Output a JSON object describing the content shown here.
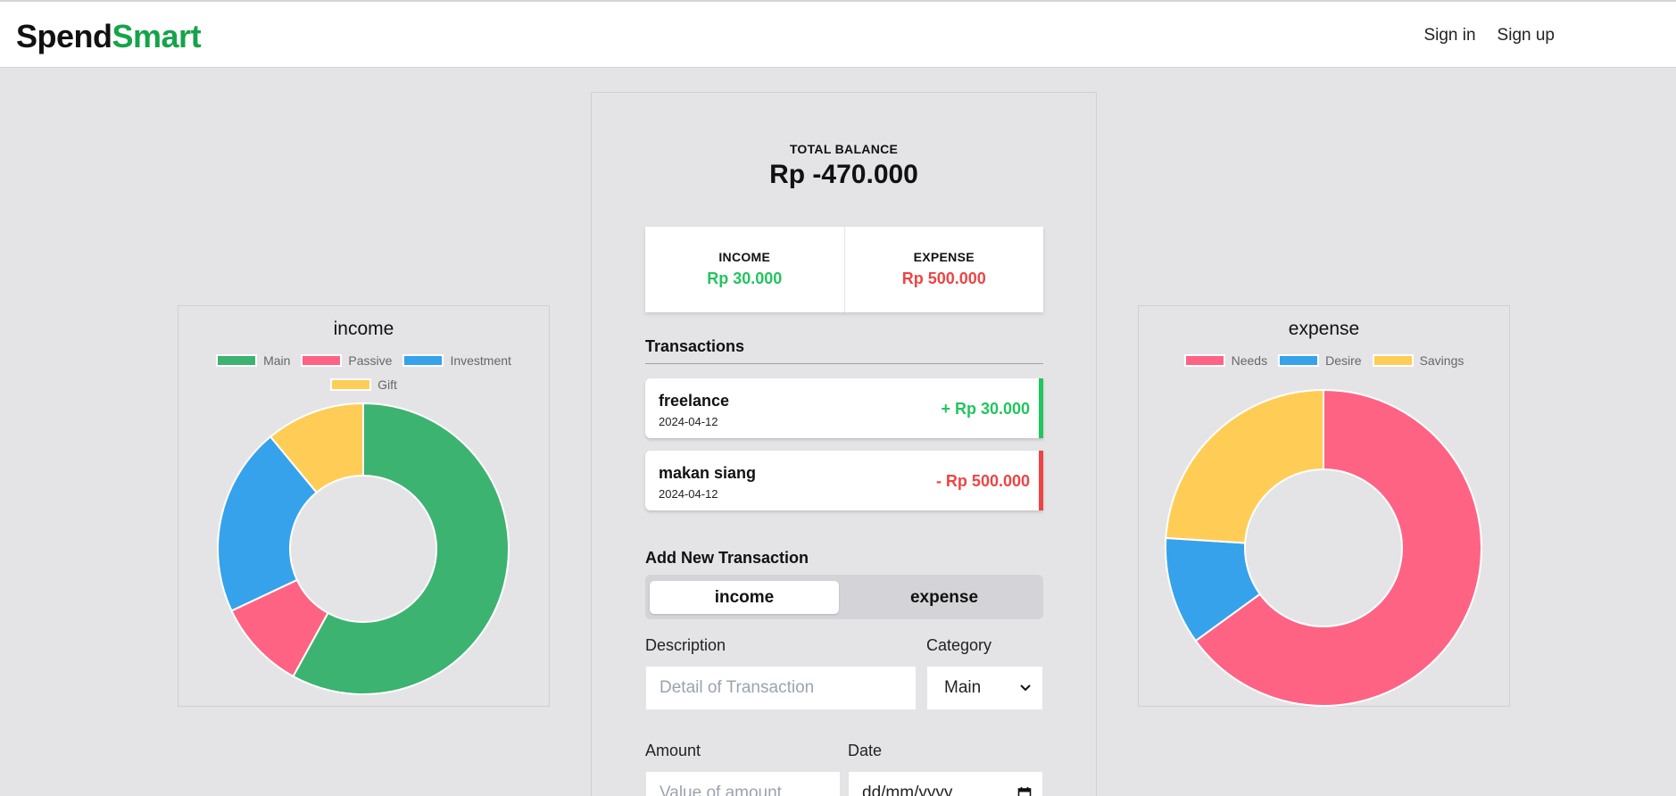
{
  "brand": {
    "part1": "Spend",
    "part2": "Smart"
  },
  "nav": {
    "sign_in": "Sign in",
    "sign_up": "Sign up"
  },
  "balance": {
    "label": "TOTAL BALANCE",
    "value": "Rp -470.000"
  },
  "summary": {
    "income_label": "INCOME",
    "income_value": "Rp 30.000",
    "expense_label": "EXPENSE",
    "expense_value": "Rp 500.000"
  },
  "transactions": {
    "title": "Transactions",
    "items": [
      {
        "name": "freelance",
        "date": "2024-04-12",
        "amount": "+ Rp 30.000",
        "type": "income"
      },
      {
        "name": "makan siang",
        "date": "2024-04-12",
        "amount": "- Rp 500.000",
        "type": "expense"
      }
    ]
  },
  "form": {
    "title": "Add New Transaction",
    "tab_income": "income",
    "tab_expense": "expense",
    "description_label": "Description",
    "description_placeholder": "Detail of Transaction",
    "category_label": "Category",
    "category_value": "Main",
    "amount_label": "Amount",
    "amount_placeholder": "Value of amount",
    "date_label": "Date",
    "date_placeholder": "dd/mm/yyyy"
  },
  "colors": {
    "green": "#3cb371",
    "pink": "#ff6384",
    "blue": "#36a2eb",
    "yellow": "#ffcd56",
    "brand_green": "#16a34a",
    "income_green": "#22c55e",
    "expense_red": "#ef4444"
  },
  "icons": {
    "category_select": "chevron-down-icon",
    "date_picker": "calendar-icon"
  },
  "chart_data": [
    {
      "type": "pie",
      "title": "income",
      "categories": [
        "Main",
        "Passive",
        "Investment",
        "Gift"
      ],
      "values": [
        58,
        10,
        21,
        11
      ],
      "colors": [
        "#3cb371",
        "#ff6384",
        "#36a2eb",
        "#ffcd56"
      ]
    },
    {
      "type": "pie",
      "title": "expense",
      "categories": [
        "Needs",
        "Desire",
        "Savings"
      ],
      "values": [
        65,
        11,
        24
      ],
      "colors": [
        "#ff6384",
        "#36a2eb",
        "#ffcd56"
      ]
    }
  ]
}
